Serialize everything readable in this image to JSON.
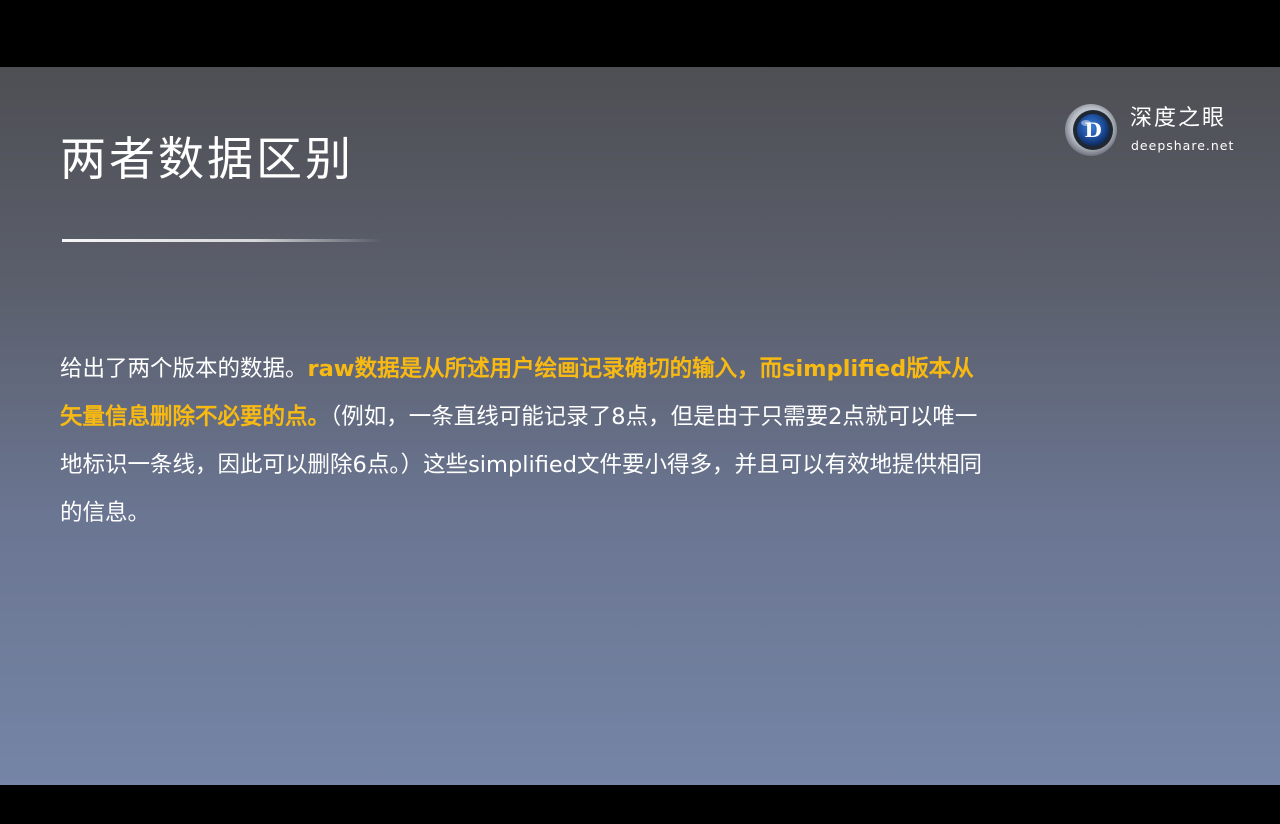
{
  "slide": {
    "title": "两者数据区别",
    "logo": {
      "name_cn": "深度之眼",
      "domain": "deepshare.net",
      "mark_letter": "D"
    },
    "paragraph": {
      "intro": "给出了两个版本的数据。",
      "highlight": "raw数据是从所述用户绘画记录确切的输入，而simplified版本从矢量信息删除不必要的点。",
      "rest": "（例如，一条直线可能记录了8点，但是由于只需要2点就可以唯一地标识一条线，因此可以删除6点。）这些simplified文件要小得多，并且可以有效地提供相同的信息。"
    },
    "colors": {
      "highlight": "#f8b912",
      "text": "#ffffff"
    }
  }
}
